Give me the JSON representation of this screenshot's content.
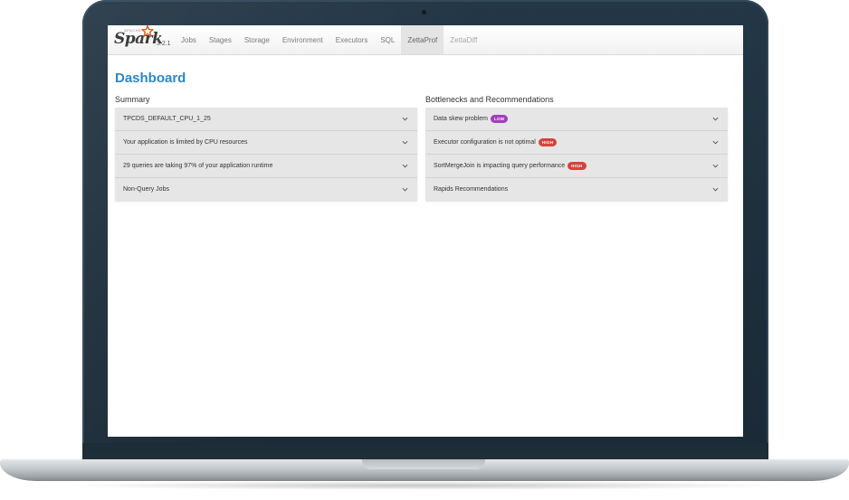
{
  "app": {
    "brand_word": "Spark",
    "brand_prefix": "APACHE",
    "version": "3.2.1"
  },
  "nav": {
    "items": [
      {
        "label": "Jobs"
      },
      {
        "label": "Stages"
      },
      {
        "label": "Storage"
      },
      {
        "label": "Environment"
      },
      {
        "label": "Executors"
      },
      {
        "label": "SQL"
      },
      {
        "label": "ZettaProf"
      },
      {
        "label": "ZettaDiff"
      }
    ],
    "active": "ZettaProf",
    "disabled": "ZettaDiff"
  },
  "page": {
    "title": "Dashboard"
  },
  "summary": {
    "title": "Summary",
    "rows": [
      {
        "label": "TPCDS_DEFAULT_CPU_1_25"
      },
      {
        "label": "Your application is limited by CPU resources"
      },
      {
        "label": "29 queries are taking 97% of your application runtime"
      },
      {
        "label": "Non-Query Jobs"
      }
    ]
  },
  "bottlenecks": {
    "title": "Bottlenecks and Recommendations",
    "rows": [
      {
        "label": "Data skew problem",
        "badge": "LOW"
      },
      {
        "label": "Executor configuration is not optimal",
        "badge": "HIGH"
      },
      {
        "label": "SortMergeJoin is impacting query performance",
        "badge": "HIGH"
      },
      {
        "label": "Rapids Recommendations",
        "badge": ""
      }
    ]
  },
  "colors": {
    "accent": "#2a88c8",
    "badge_low": "#a23fbf",
    "badge_high": "#d9423c",
    "brand_star": "#e25a1c",
    "laptop_bezel": "#1f3140"
  },
  "icons": {
    "row_toggle": "chevron-down-icon",
    "brand_mark": "spark-star-icon"
  }
}
